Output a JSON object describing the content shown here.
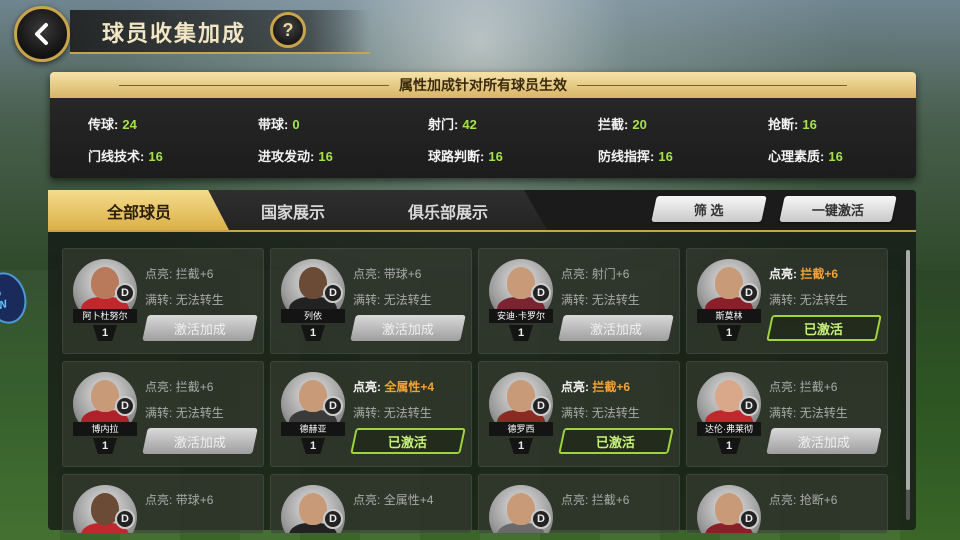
{
  "header": {
    "title": "球员收集加成",
    "help": "?"
  },
  "bonus": {
    "heading": "属性加成针对所有球员生效",
    "stats": [
      {
        "label": "传球:",
        "value": "24"
      },
      {
        "label": "带球:",
        "value": "0"
      },
      {
        "label": "射门:",
        "value": "42"
      },
      {
        "label": "拦截:",
        "value": "20"
      },
      {
        "label": "抢断:",
        "value": "16"
      },
      {
        "label": "门线技术:",
        "value": "16"
      },
      {
        "label": "进攻发动:",
        "value": "16"
      },
      {
        "label": "球路判断:",
        "value": "16"
      },
      {
        "label": "防线指挥:",
        "value": "16"
      },
      {
        "label": "心理素质:",
        "value": "16"
      }
    ]
  },
  "tabs": [
    {
      "label": "全部球员"
    },
    {
      "label": "国家展示"
    },
    {
      "label": "俱乐部展示"
    }
  ],
  "actions": {
    "filter": "筛 选",
    "activate_all": "一键激活"
  },
  "side_logo": "JO AW",
  "cards": [
    {
      "name": "阿卜杜努尔",
      "level": "1",
      "light_key": "点亮:",
      "light_val": "拦截+6",
      "trans_key": "满转:",
      "trans_val": "无法转生",
      "button": "激活加成",
      "activated": false,
      "skin": "#b87a5a",
      "kit": "#c0282e"
    },
    {
      "name": "列依",
      "level": "1",
      "light_key": "点亮:",
      "light_val": "带球+6",
      "trans_key": "满转:",
      "trans_val": "无法转生",
      "button": "激活加成",
      "activated": false,
      "skin": "#6b4a36",
      "kit": "#222222"
    },
    {
      "name": "安迪·卡罗尔",
      "level": "1",
      "light_key": "点亮:",
      "light_val": "射门+6",
      "trans_key": "满转:",
      "trans_val": "无法转生",
      "button": "激活加成",
      "activated": false,
      "skin": "#c99a78",
      "kit": "#7a2430"
    },
    {
      "name": "斯莫林",
      "level": "1",
      "light_key": "点亮:",
      "light_val": "拦截+6",
      "trans_key": "满转:",
      "trans_val": "无法转生",
      "button": "已激活",
      "activated": true,
      "skin": "#c99a78",
      "kit": "#8a1f2a"
    },
    {
      "name": "博内拉",
      "level": "1",
      "light_key": "点亮:",
      "light_val": "拦截+6",
      "trans_key": "满转:",
      "trans_val": "无法转生",
      "button": "激活加成",
      "activated": false,
      "skin": "#c99a78",
      "kit": "#b0202a"
    },
    {
      "name": "德赫亚",
      "level": "1",
      "light_key": "点亮:",
      "light_val": "全属性+4",
      "trans_key": "满转:",
      "trans_val": "无法转生",
      "button": "已激活",
      "activated": true,
      "skin": "#c99a78",
      "kit": "#3a3a3a"
    },
    {
      "name": "德罗西",
      "level": "1",
      "light_key": "点亮:",
      "light_val": "拦截+6",
      "trans_key": "满转:",
      "trans_val": "无法转生",
      "button": "已激活",
      "activated": true,
      "skin": "#c99a78",
      "kit": "#8a2a22"
    },
    {
      "name": "达伦·弗莱彻",
      "level": "1",
      "light_key": "点亮:",
      "light_val": "拦截+6",
      "trans_key": "满转:",
      "trans_val": "无法转生",
      "button": "激活加成",
      "activated": false,
      "skin": "#d9a88a",
      "kit": "#c0282e"
    },
    {
      "name": "",
      "level": "",
      "light_key": "点亮:",
      "light_val": "带球+6",
      "trans_key": "",
      "trans_val": "",
      "button": "",
      "activated": false,
      "skin": "#6b4a36",
      "kit": "#c0282e"
    },
    {
      "name": "",
      "level": "",
      "light_key": "点亮:",
      "light_val": "全属性+4",
      "trans_key": "",
      "trans_val": "",
      "button": "",
      "activated": false,
      "skin": "#c99a78",
      "kit": "#222222"
    },
    {
      "name": "",
      "level": "",
      "light_key": "点亮:",
      "light_val": "拦截+6",
      "trans_key": "",
      "trans_val": "",
      "button": "",
      "activated": false,
      "skin": "#c99a78",
      "kit": "#6a6a6a"
    },
    {
      "name": "",
      "level": "",
      "light_key": "点亮:",
      "light_val": "抢断+6",
      "trans_key": "",
      "trans_val": "",
      "button": "",
      "activated": false,
      "skin": "#c99a78",
      "kit": "#8a1f2a"
    }
  ]
}
